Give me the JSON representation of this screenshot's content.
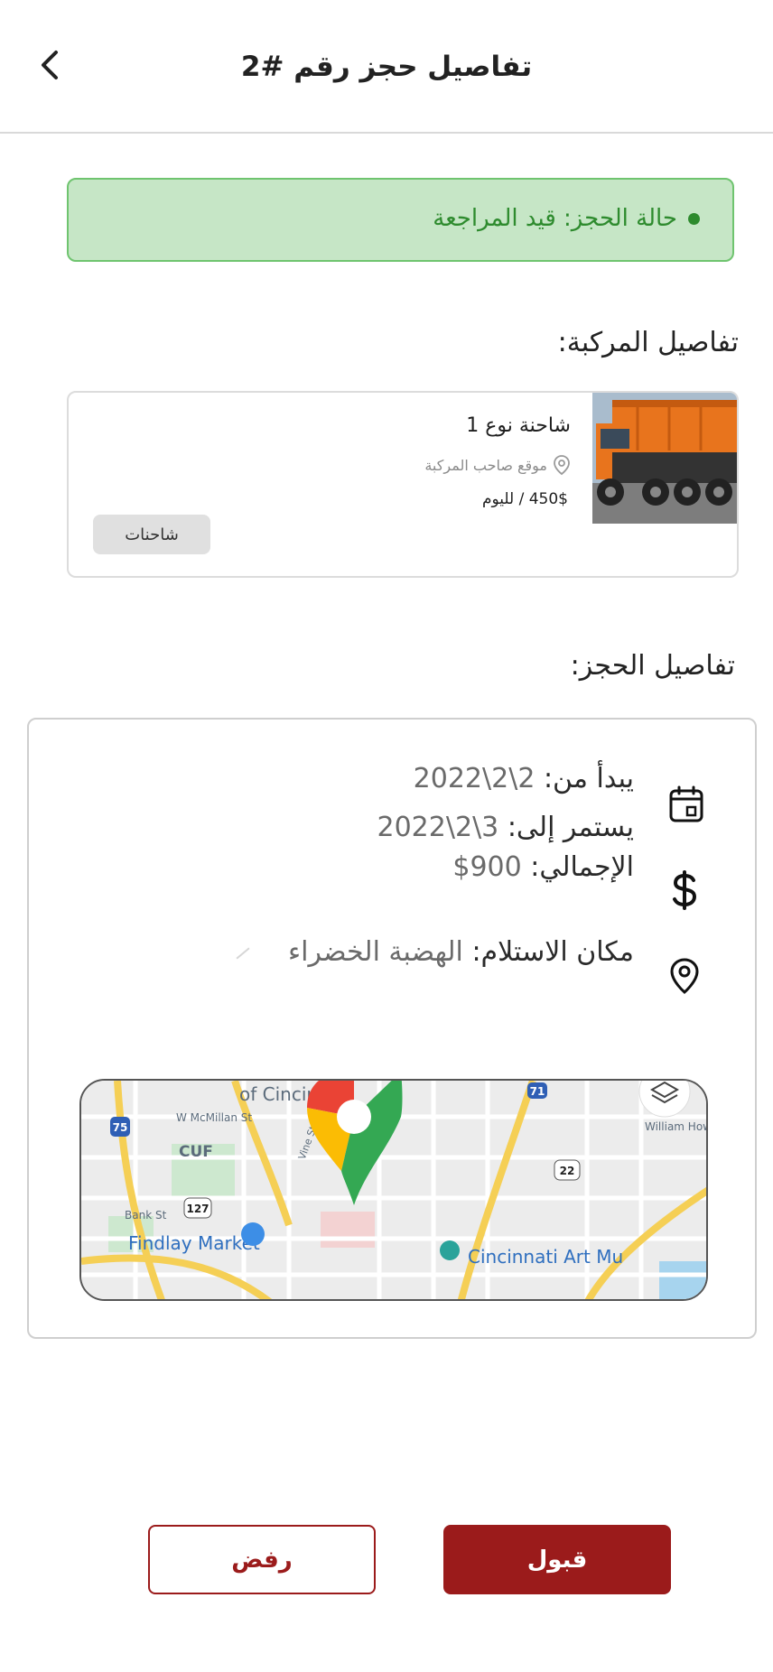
{
  "header": {
    "title": "تفاصيل حجز رقم #2"
  },
  "status": {
    "text": "حالة الحجز: قيد المراجعة",
    "color": "#2e8b2e",
    "background": "#c6e6c6"
  },
  "vehicle_section": {
    "title": "تفاصيل المركبة:",
    "card": {
      "name": "شاحنة نوع 1",
      "location": "موقع صاحب المركبة",
      "price": "450$ / لليوم",
      "category": "شاحنات",
      "image_icon": "truck-photo"
    }
  },
  "booking_section": {
    "title": "تفاصيل الحجز:",
    "start_label": "يبدأ من:",
    "start_value": "2\\2\\2022",
    "end_label": "يستمر إلى:",
    "end_value": "3\\2\\2022",
    "total_label": "الإجمالي:",
    "total_value": "900$",
    "pickup_label": "مكان الاستلام:",
    "pickup_value": "الهضبة الخضراء",
    "icons": [
      "calendar-icon",
      "dollar-icon",
      "location-pin-icon"
    ]
  },
  "map": {
    "labels": [
      "of Cincin",
      "W McMillan St",
      "CUF",
      "William How",
      "Bank St",
      "Findlay Market",
      "Cincinnati Art Mu",
      "Vine St"
    ],
    "shields": [
      "75",
      "71",
      "22",
      "127"
    ]
  },
  "actions": {
    "accept_label": "قبول",
    "reject_label": "رفض",
    "accent": "#9b1b1b"
  }
}
